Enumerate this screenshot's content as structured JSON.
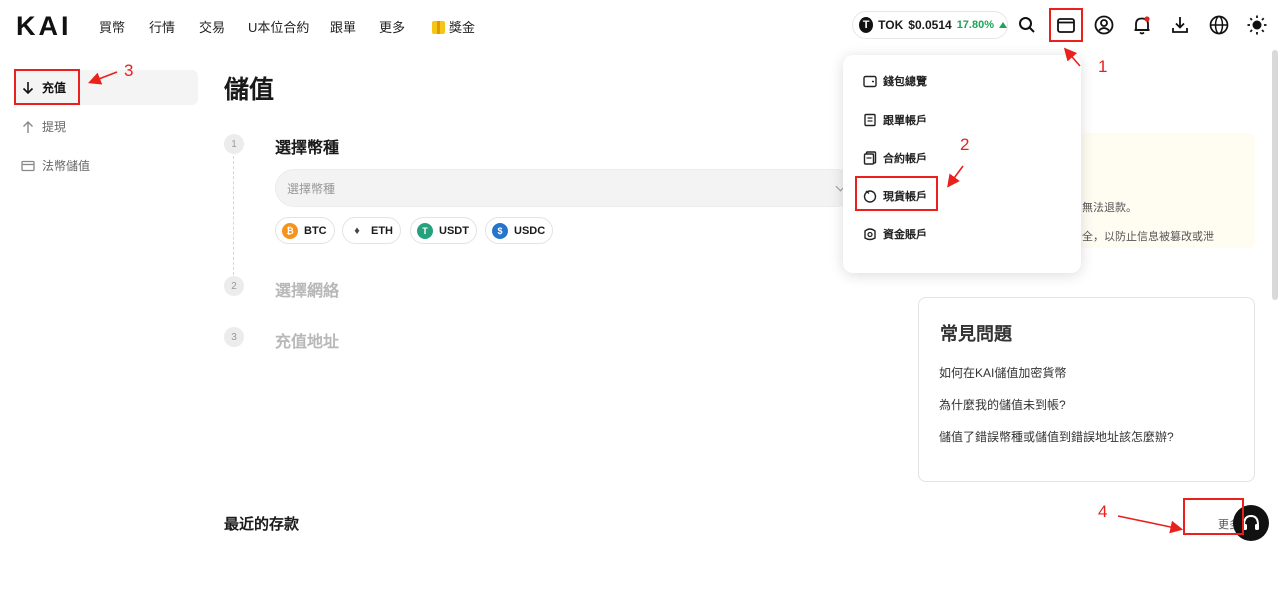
{
  "brand": {
    "logo": "KAI"
  },
  "nav": [
    {
      "label": "買幣"
    },
    {
      "label": "行情"
    },
    {
      "label": "交易"
    },
    {
      "label": "U本位合約"
    },
    {
      "label": "跟單"
    },
    {
      "label": "更多"
    },
    {
      "label": "獎金"
    }
  ],
  "ticker": {
    "symbol": "TOK",
    "price": "$0.0514",
    "change": "17.80%",
    "up_color": "#1aa35a"
  },
  "sidebar": {
    "items": [
      {
        "label": "充值",
        "icon": "arrow-down-icon",
        "active": true
      },
      {
        "label": "提現",
        "icon": "arrow-up-icon",
        "active": false
      },
      {
        "label": "法幣儲值",
        "icon": "card-icon",
        "active": false
      }
    ]
  },
  "main": {
    "title": "儲值",
    "steps": [
      {
        "num": "1",
        "title": "選擇幣種"
      },
      {
        "num": "2",
        "title": "選擇網絡"
      },
      {
        "num": "3",
        "title": "充值地址"
      }
    ],
    "select_placeholder": "選擇幣種",
    "coins": [
      {
        "symbol": "BTC",
        "color": "#f7931a",
        "glyph": "₿"
      },
      {
        "symbol": "ETH",
        "color": "#444444",
        "glyph": "♦"
      },
      {
        "symbol": "USDT",
        "color": "#26a17b",
        "glyph": "T"
      },
      {
        "symbol": "USDC",
        "color": "#2775ca",
        "glyph": "$"
      }
    ],
    "notice_lines": [
      "無法退款。",
      "全，以防止信息被篡改或泄"
    ],
    "recent_title": "最近的存款",
    "more_label": "更多"
  },
  "faq": {
    "title": "常見問題",
    "questions": [
      "如何在KAI儲值加密貨幣",
      "為什麼我的儲值未到帳?",
      "儲值了錯誤幣種或儲值到錯誤地址該怎麼辦?"
    ]
  },
  "wallet_menu": {
    "items": [
      {
        "label": "錢包總覽",
        "icon": "wallet-icon"
      },
      {
        "label": "跟單帳戶",
        "icon": "copy-trade-icon"
      },
      {
        "label": "合約帳戶",
        "icon": "contract-icon"
      },
      {
        "label": "現貨帳戶",
        "icon": "spot-icon"
      },
      {
        "label": "資金賬戶",
        "icon": "funding-icon"
      }
    ]
  },
  "annotations": {
    "n1": "1",
    "n2": "2",
    "n3": "3",
    "n4": "4",
    "color": "#e8211d"
  }
}
